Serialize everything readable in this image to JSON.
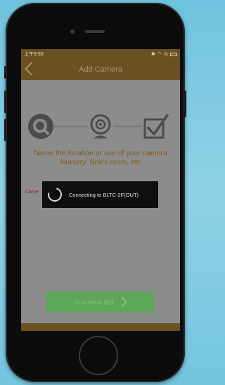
{
  "statusbar": {
    "time": "上午9:55",
    "icons": [
      "bluetooth-icon",
      "wifi-icon",
      "alarm-icon",
      "battery-icon"
    ]
  },
  "navbar": {
    "title": "Add Camera",
    "back_icon": "chevron-left-icon"
  },
  "steps": [
    {
      "icon": "search-icon"
    },
    {
      "icon": "camera-icon"
    },
    {
      "icon": "checkbox-icon"
    }
  ],
  "prompt": "Name the location or use of your camera Nursery, Bob's room, etc",
  "camera_name_label": "Came",
  "toast": {
    "message": "Connecting to BLTC-2F(OUT)",
    "icon": "spinner-icon"
  },
  "continue_button": {
    "label": "CONTINUE 继续"
  },
  "colors": {
    "header": "#6b5022",
    "overlay": "#8c8c8c",
    "button": "#5ea65a",
    "prompt": "#855a0e",
    "background": "#6fc3de"
  }
}
